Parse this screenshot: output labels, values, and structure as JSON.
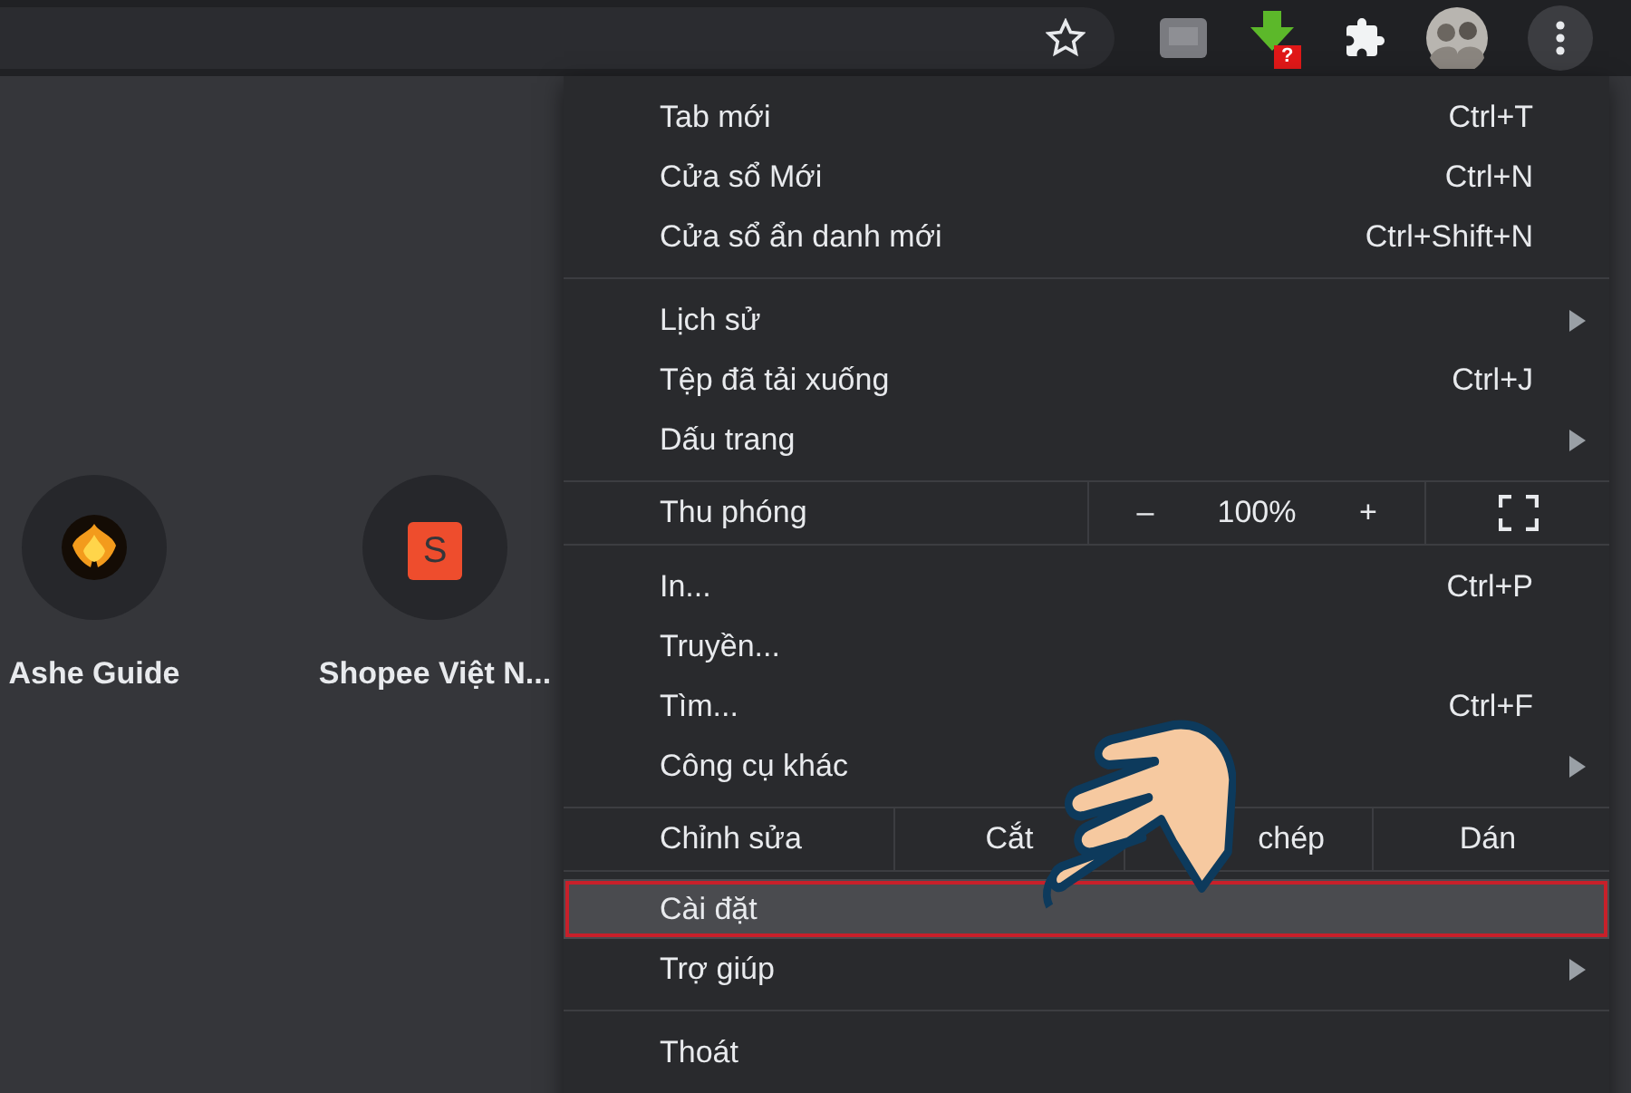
{
  "toolbar": {
    "download_badge": "?"
  },
  "shortcuts": [
    {
      "label": "Ashe Guide",
      "kind": "emblem"
    },
    {
      "label": "Shopee Việt N...",
      "kind": "bag",
      "logo_letter": "S"
    }
  ],
  "menu": {
    "sections": [
      {
        "kind": "list",
        "items": [
          {
            "label": "Tab mới",
            "shortcut": "Ctrl+T",
            "submenu": false,
            "selected": false
          },
          {
            "label": "Cửa sổ Mới",
            "shortcut": "Ctrl+N",
            "submenu": false,
            "selected": false
          },
          {
            "label": "Cửa sổ ẩn danh mới",
            "shortcut": "Ctrl+Shift+N",
            "submenu": false,
            "selected": false
          }
        ]
      },
      {
        "kind": "list",
        "items": [
          {
            "label": "Lịch sử",
            "submenu": true,
            "selected": false
          },
          {
            "label": "Tệp đã tải xuống",
            "shortcut": "Ctrl+J",
            "submenu": false,
            "selected": false
          },
          {
            "label": "Dấu trang",
            "submenu": true,
            "selected": false
          }
        ]
      },
      {
        "kind": "zoom",
        "label": "Thu phóng",
        "minus": "–",
        "value": "100%",
        "plus": "+"
      },
      {
        "kind": "list",
        "items": [
          {
            "label": "In...",
            "shortcut": "Ctrl+P",
            "submenu": false,
            "selected": false
          },
          {
            "label": "Truyền...",
            "submenu": false,
            "selected": false
          },
          {
            "label": "Tìm...",
            "shortcut": "Ctrl+F",
            "submenu": false,
            "selected": false
          },
          {
            "label": "Công cụ khác",
            "submenu": true,
            "selected": false
          }
        ]
      },
      {
        "kind": "edit",
        "label": "Chỉnh sửa",
        "actions": [
          "Cắt",
          "chép",
          "Dán"
        ]
      },
      {
        "kind": "list",
        "items": [
          {
            "label": "Cài đặt",
            "submenu": false,
            "selected": true
          },
          {
            "label": "Trợ giúp",
            "submenu": true,
            "selected": false
          }
        ]
      },
      {
        "kind": "list",
        "items": [
          {
            "label": "Thoát",
            "submenu": false,
            "selected": false
          }
        ]
      }
    ]
  }
}
